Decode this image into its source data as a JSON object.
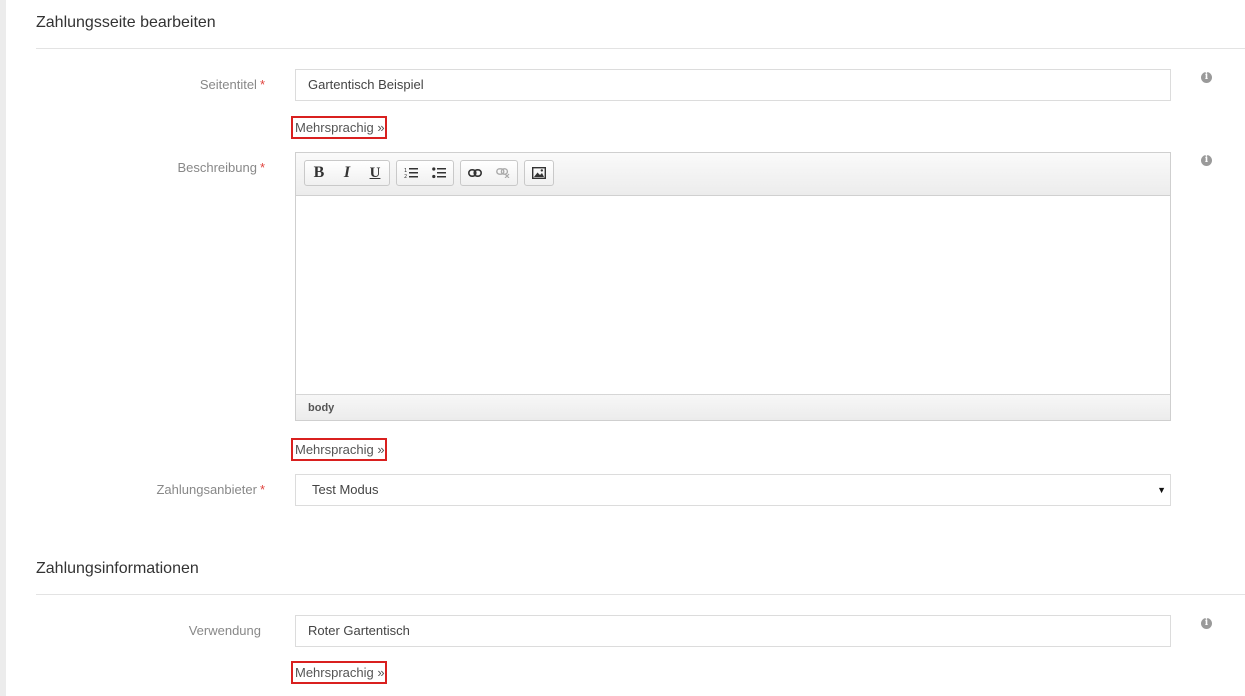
{
  "sections": {
    "payment_page_title": "Zahlungsseite bearbeiten",
    "payment_info_title": "Zahlungsinformationen"
  },
  "fields": {
    "page_title": {
      "label": "Seitentitel",
      "required_mark": "*",
      "value": "Gartentisch Beispiel"
    },
    "description": {
      "label": "Beschreibung",
      "required_mark": "*"
    },
    "provider": {
      "label": "Zahlungsanbieter",
      "required_mark": "*",
      "value": "Test Modus"
    },
    "usage": {
      "label": "Verwendung",
      "value": "Roter Gartentisch"
    }
  },
  "multilingual_link": "Mehrsprachig »",
  "editor": {
    "status_path": "body",
    "toolbar": [
      "bold-icon",
      "italic-icon",
      "underline-icon",
      "ordered-list-icon",
      "unordered-list-icon",
      "link-icon",
      "unlink-icon",
      "image-icon"
    ]
  },
  "colors": {
    "required": "#e0443e",
    "highlight_border": "#d9201f"
  }
}
